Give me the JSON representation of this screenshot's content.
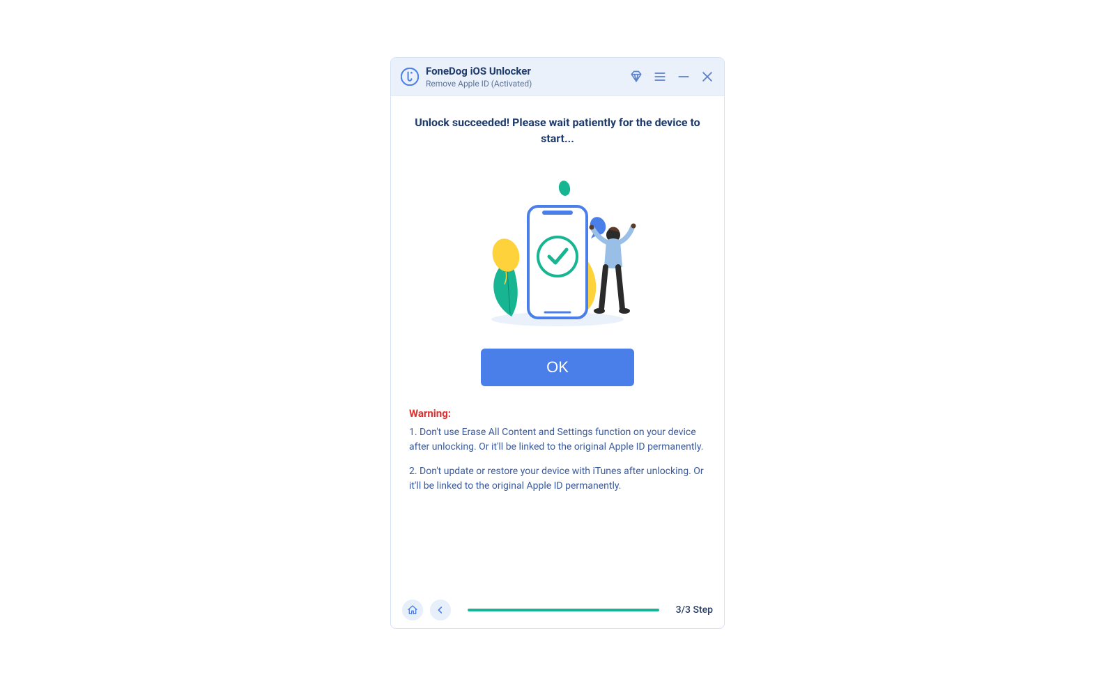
{
  "header": {
    "app_title": "FoneDog iOS Unlocker",
    "subtitle": "Remove Apple ID  (Activated)"
  },
  "main": {
    "headline": "Unlock succeeded! Please wait patiently for the device to start...",
    "ok_label": "OK",
    "warning_heading": "Warning:",
    "warning_1": "1. Don't use Erase All Content and Settings function on your device after unlocking. Or it'll be linked to the original Apple ID permanently.",
    "warning_2": "2. Don't update or restore your device with iTunes after unlocking. Or it'll be linked to the original Apple ID permanently."
  },
  "footer": {
    "step_label": "3/3 Step",
    "progress_percent": 100
  },
  "icons": {
    "diamond": "diamond-icon",
    "menu": "menu-icon",
    "minimize": "minimize-icon",
    "close": "close-icon",
    "home": "home-icon",
    "back": "chevron-left-icon"
  },
  "colors": {
    "primary": "#4a7ee8",
    "accent": "#17b591",
    "heading": "#1f3b6b",
    "link_text": "#3b5a9c",
    "danger": "#e0312f",
    "titlebar_bg": "#eaf1fb"
  }
}
